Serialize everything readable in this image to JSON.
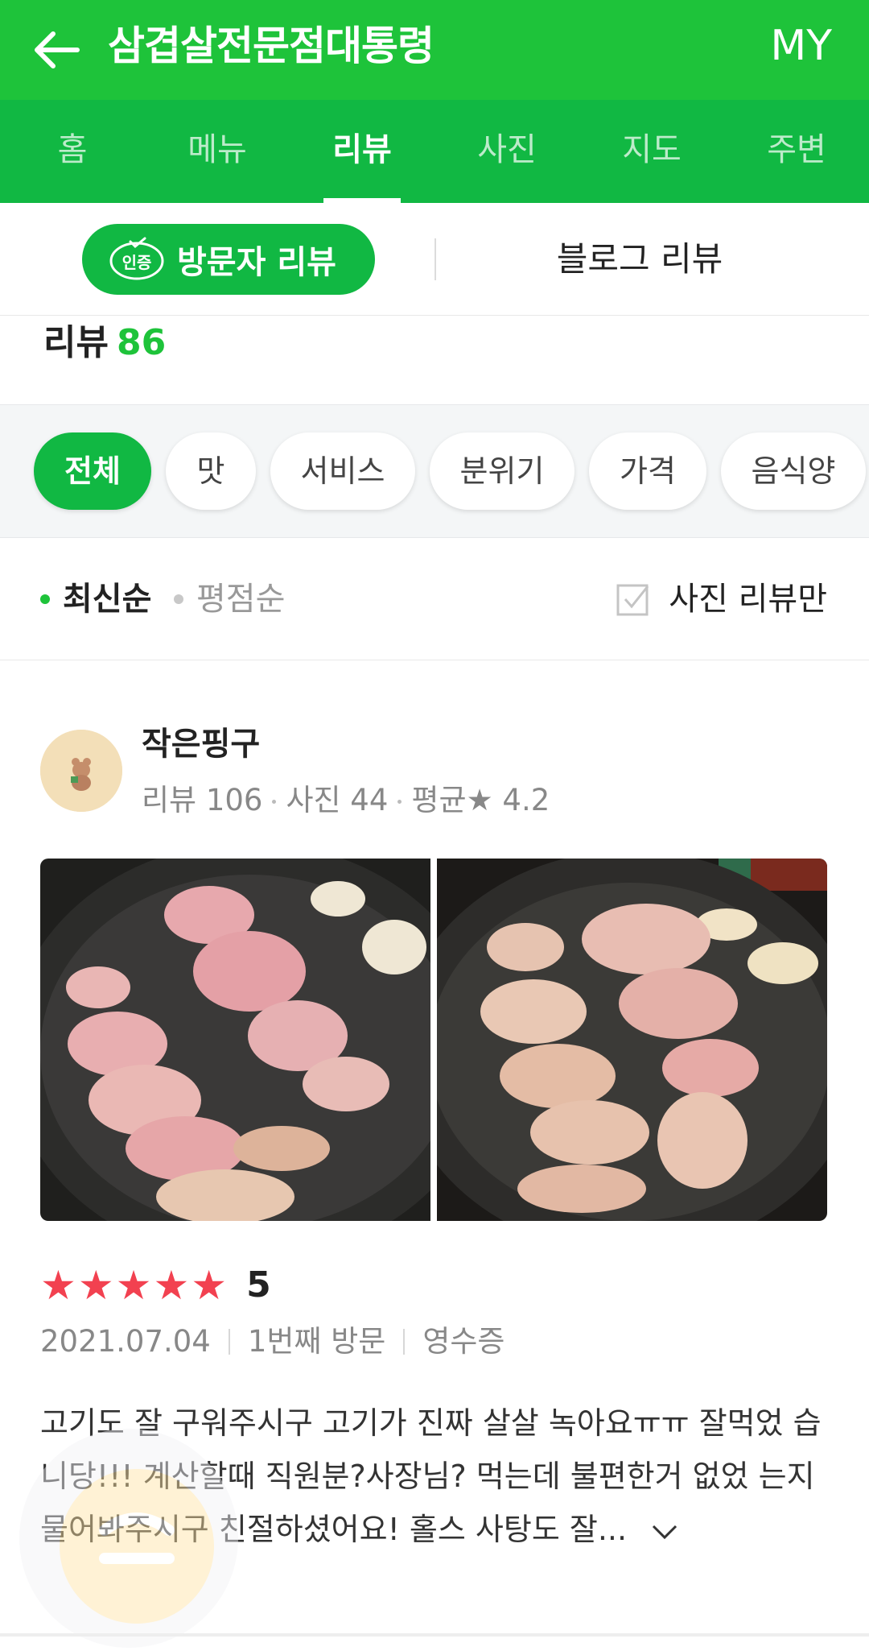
{
  "header": {
    "title": "삼겹살전문점대통령",
    "right_label": "MY",
    "back_icon": "arrow-left-icon"
  },
  "tabs": [
    {
      "label": "홈",
      "active": false
    },
    {
      "label": "메뉴",
      "active": false
    },
    {
      "label": "리뷰",
      "active": true
    },
    {
      "label": "사진",
      "active": false
    },
    {
      "label": "지도",
      "active": false
    },
    {
      "label": "주변",
      "active": false
    }
  ],
  "review_type": {
    "cert_badge": "인증",
    "visitor": "방문자 리뷰",
    "blog": "블로그 리뷰"
  },
  "reviews_heading": {
    "label": "리뷰",
    "count": "86"
  },
  "filters": [
    {
      "label": "전체",
      "active": true
    },
    {
      "label": "맛",
      "active": false
    },
    {
      "label": "서비스",
      "active": false
    },
    {
      "label": "분위기",
      "active": false
    },
    {
      "label": "가격",
      "active": false
    },
    {
      "label": "음식양",
      "active": false
    }
  ],
  "sort": {
    "latest": "최신순",
    "rating": "평점순",
    "photo_only": "사진 리뷰만",
    "photo_only_checked": false
  },
  "review": {
    "user": {
      "name": "작은핑구",
      "reviews": "리뷰 106",
      "photos": "사진 44",
      "avg": "평균★ 4.2"
    },
    "stars": "★★★★★",
    "score": "5",
    "date": "2021.07.04",
    "visit": "1번째 방문",
    "receipt": "영수증",
    "text": "고기도 잘 구워주시구 고기가 진짜 살살 녹아요ㅠㅠ 잘먹었 습니당!!! 계산할때 직원분?사장님? 먹는데 불편한거 없었 는지 물어봐주시구 친절하셨어요! 홀스 사탕도 잘..."
  },
  "colors": {
    "brand": "#1ec33a",
    "tab_bar": "#11b843",
    "star": "#f24150"
  }
}
